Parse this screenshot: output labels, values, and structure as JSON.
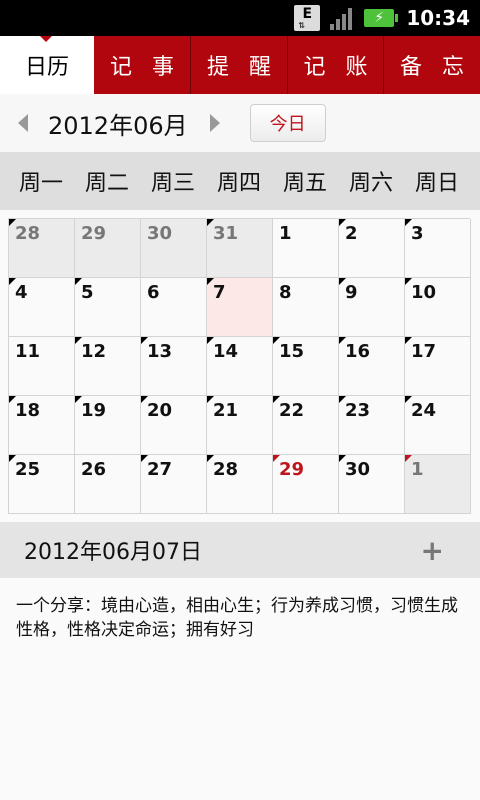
{
  "status": {
    "time": "10:34",
    "e_label": "E"
  },
  "tabs": [
    {
      "label": "日历",
      "active": true
    },
    {
      "label": "记事",
      "active": false
    },
    {
      "label": "提醒",
      "active": false
    },
    {
      "label": "记账",
      "active": false
    },
    {
      "label": "备忘",
      "active": false
    }
  ],
  "month_nav": {
    "title": "2012年06月",
    "today_label": "今日"
  },
  "weekdays": [
    "周一",
    "周二",
    "周三",
    "周四",
    "周五",
    "周六",
    "周日"
  ],
  "days": [
    {
      "d": "28",
      "other": true,
      "mark": "black"
    },
    {
      "d": "29",
      "other": true,
      "mark": "none"
    },
    {
      "d": "30",
      "other": true,
      "mark": "none"
    },
    {
      "d": "31",
      "other": true,
      "mark": "black"
    },
    {
      "d": "1",
      "mark": "none"
    },
    {
      "d": "2",
      "mark": "black"
    },
    {
      "d": "3",
      "mark": "black"
    },
    {
      "d": "4",
      "mark": "black"
    },
    {
      "d": "5",
      "mark": "black"
    },
    {
      "d": "6",
      "mark": "none"
    },
    {
      "d": "7",
      "selected": true,
      "mark": "black"
    },
    {
      "d": "8",
      "mark": "none"
    },
    {
      "d": "9",
      "mark": "black"
    },
    {
      "d": "10",
      "mark": "black"
    },
    {
      "d": "11",
      "mark": "none"
    },
    {
      "d": "12",
      "mark": "black"
    },
    {
      "d": "13",
      "mark": "black"
    },
    {
      "d": "14",
      "mark": "black"
    },
    {
      "d": "15",
      "mark": "black"
    },
    {
      "d": "16",
      "mark": "black"
    },
    {
      "d": "17",
      "mark": "black"
    },
    {
      "d": "18",
      "mark": "black"
    },
    {
      "d": "19",
      "mark": "black"
    },
    {
      "d": "20",
      "mark": "black"
    },
    {
      "d": "21",
      "mark": "black"
    },
    {
      "d": "22",
      "mark": "black"
    },
    {
      "d": "23",
      "mark": "black"
    },
    {
      "d": "24",
      "mark": "black"
    },
    {
      "d": "25",
      "mark": "black"
    },
    {
      "d": "26",
      "mark": "none"
    },
    {
      "d": "27",
      "mark": "black"
    },
    {
      "d": "28",
      "mark": "black"
    },
    {
      "d": "29",
      "holiday": true,
      "mark": "red"
    },
    {
      "d": "30",
      "mark": "black"
    },
    {
      "d": "1",
      "other": true,
      "mark": "red"
    }
  ],
  "selected_date": {
    "text": "2012年06月07日",
    "add_label": "+"
  },
  "note": {
    "text": "一个分享：境由心造，相由心生；行为养成习惯，习惯生成性格，性格决定命运；拥有好习"
  },
  "colors": {
    "accent": "#b1060d",
    "holiday": "#c0141c",
    "selected_bg": "#fde8e8"
  }
}
